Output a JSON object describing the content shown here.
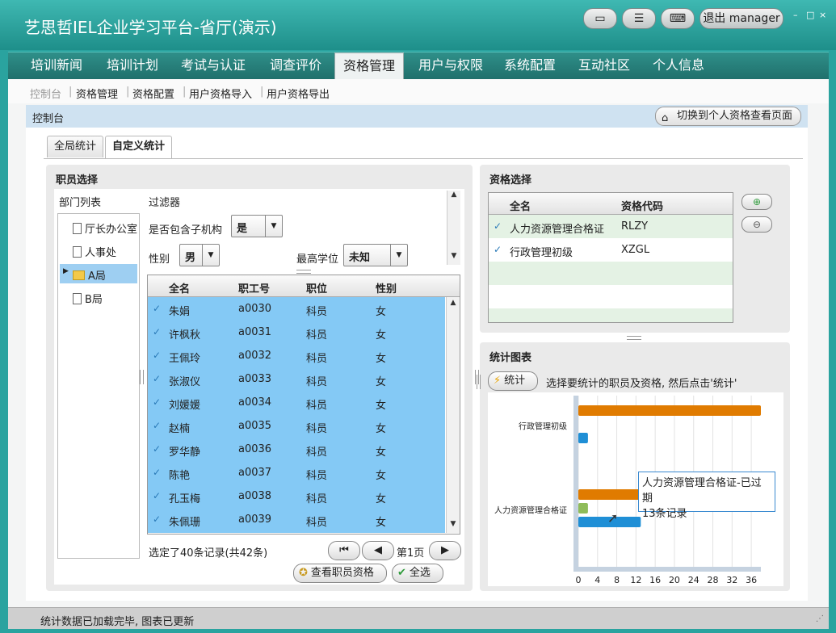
{
  "app": {
    "title": "艺思哲IEL企业学习平台-省厅(演示)",
    "logout_label": "退出 manager",
    "min_label": "–",
    "max_label": "□",
    "close_label": "×"
  },
  "menu": [
    "培训新闻",
    "培训计划",
    "考试与认证",
    "调查评价",
    "资格管理",
    "用户与权限",
    "系统配置",
    "互动社区",
    "个人信息"
  ],
  "menu_active": "资格管理",
  "subnav": [
    "控制台",
    "资格管理",
    "资格配置",
    "用户资格导入",
    "用户资格导出"
  ],
  "crumb": "控制台",
  "switch_button": "切换到个人资格查看页面",
  "tabs": [
    "全局统计",
    "自定义统计"
  ],
  "staff_panel": {
    "title": "职员选择",
    "dept_label": "部门列表",
    "filter_label": "过滤器",
    "depts": [
      "厅长办公室",
      "人事处",
      "A局",
      "B局"
    ],
    "selected_dept": "A局",
    "include_sub_label": "是否包含子机构",
    "include_sub_value": "是",
    "gender_label": "性别",
    "gender_value": "男",
    "degree_label": "最高学位",
    "degree_value": "未知",
    "columns": [
      "全名",
      "职工号",
      "职位",
      "性别"
    ],
    "rows": [
      [
        "朱娟",
        "a0030",
        "科员",
        "女"
      ],
      [
        "许枫秋",
        "a0031",
        "科员",
        "女"
      ],
      [
        "王佩玲",
        "a0032",
        "科员",
        "女"
      ],
      [
        "张淑仪",
        "a0033",
        "科员",
        "女"
      ],
      [
        "刘媛媛",
        "a0034",
        "科员",
        "女"
      ],
      [
        "赵楠",
        "a0035",
        "科员",
        "女"
      ],
      [
        "罗华静",
        "a0036",
        "科员",
        "女"
      ],
      [
        "陈艳",
        "a0037",
        "科员",
        "女"
      ],
      [
        "孔玉梅",
        "a0038",
        "科员",
        "女"
      ],
      [
        "朱佩珊",
        "a0039",
        "科员",
        "女"
      ]
    ],
    "selection_text": "选定了40条记录(共42条)",
    "page_label": "第1页",
    "view_button": "查看职员资格",
    "select_all_button": "全选"
  },
  "qual_panel": {
    "title": "资格选择",
    "columns": [
      "全名",
      "资格代码"
    ],
    "rows": [
      [
        "人力资源管理合格证",
        "RLZY"
      ],
      [
        "行政管理初级",
        "XZGL"
      ]
    ]
  },
  "chart_panel": {
    "title": "统计图表",
    "stat_button": "统计",
    "hint": "选择要统计的职员及资格, 然后点击'统计'",
    "tooltip_line1": "人力资源管理合格证-已过期",
    "tooltip_line2": "13条记录"
  },
  "chart_data": {
    "type": "bar",
    "orientation": "horizontal",
    "categories": [
      "行政管理初级",
      "人力资源管理合格证"
    ],
    "xticks": [
      0,
      4,
      8,
      12,
      16,
      20,
      24,
      28,
      32,
      36
    ],
    "xlim": [
      0,
      38
    ],
    "series": [
      {
        "color": "#e07b00",
        "values": [
          38,
          13
        ]
      },
      {
        "color": "#8fbc5a",
        "values": [
          0,
          2
        ]
      },
      {
        "color": "#1f8fd6",
        "values": [
          2,
          13
        ]
      }
    ]
  },
  "status": "统计数据已加载完毕, 图表已更新"
}
